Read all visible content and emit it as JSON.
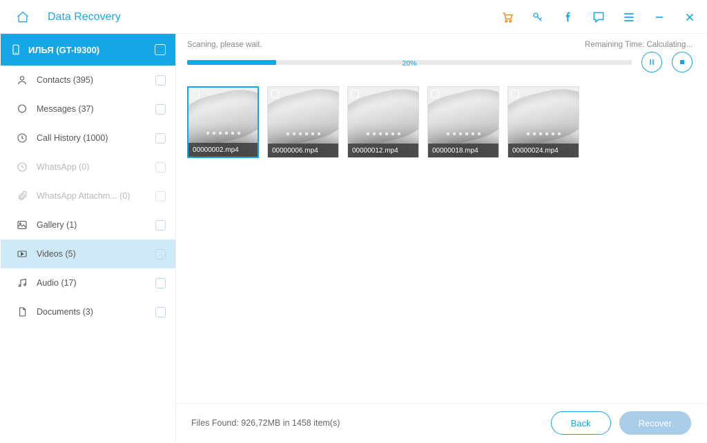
{
  "header": {
    "title": "Data Recovery"
  },
  "device": {
    "label": "ИЛЬЯ (GT-I9300)"
  },
  "categories": [
    {
      "icon": "contacts",
      "label": "Contacts (395)",
      "disabled": false
    },
    {
      "icon": "messages",
      "label": "Messages (37)",
      "disabled": false
    },
    {
      "icon": "callhistory",
      "label": "Call History (1000)",
      "disabled": false
    },
    {
      "icon": "whatsapp",
      "label": "WhatsApp (0)",
      "disabled": true
    },
    {
      "icon": "attachment",
      "label": "WhatsApp Attachm...  (0)",
      "disabled": true
    },
    {
      "icon": "gallery",
      "label": "Gallery (1)",
      "disabled": false
    },
    {
      "icon": "videos",
      "label": "Videos (5)",
      "disabled": false,
      "selected": true
    },
    {
      "icon": "audio",
      "label": "Audio (17)",
      "disabled": false
    },
    {
      "icon": "documents",
      "label": "Documents (3)",
      "disabled": false
    }
  ],
  "progress": {
    "status": "Scaning, please wait.",
    "remaining": "Remaining Time: Calculating...",
    "percent_text": "20%",
    "percent_value": 20
  },
  "thumbs": [
    {
      "label": "00000002.mp4",
      "selected": true
    },
    {
      "label": "00000006.mp4",
      "selected": false
    },
    {
      "label": "00000012.mp4",
      "selected": false
    },
    {
      "label": "00000018.mp4",
      "selected": false
    },
    {
      "label": "00000024.mp4",
      "selected": false
    }
  ],
  "footer": {
    "summary": "Files Found: 926,72MB in 1458 item(s)",
    "back": "Back",
    "recover": "Recover"
  }
}
